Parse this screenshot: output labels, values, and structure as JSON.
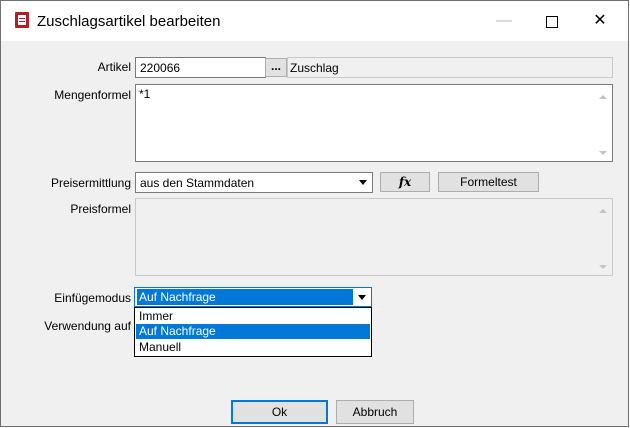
{
  "window": {
    "title": "Zuschlagsartikel bearbeiten",
    "minimize": "—",
    "close": "✕"
  },
  "form": {
    "artikel_label": "Artikel",
    "artikel_value": "220066",
    "artikel_browse": "...",
    "artikel_name": "Zuschlag",
    "mengenformel_label": "Mengenformel",
    "mengenformel_value": "*1",
    "preisermittlung_label": "Preisermittlung",
    "preisermittlung_value": "aus den Stammdaten",
    "fx_label": "fx",
    "formeltest_label": "Formeltest",
    "preisformel_label": "Preisformel",
    "preisformel_value": "",
    "einfuegemodus_label": "Einfügemodus",
    "einfuegemodus_value": "Auf Nachfrage",
    "verwendung_label": "Verwendung auf"
  },
  "dropdown": {
    "options": [
      "Immer",
      "Auf Nachfrage",
      "Manuell"
    ],
    "selected": "Auf Nachfrage"
  },
  "buttons": {
    "ok": "Ok",
    "cancel": "Abbruch"
  }
}
